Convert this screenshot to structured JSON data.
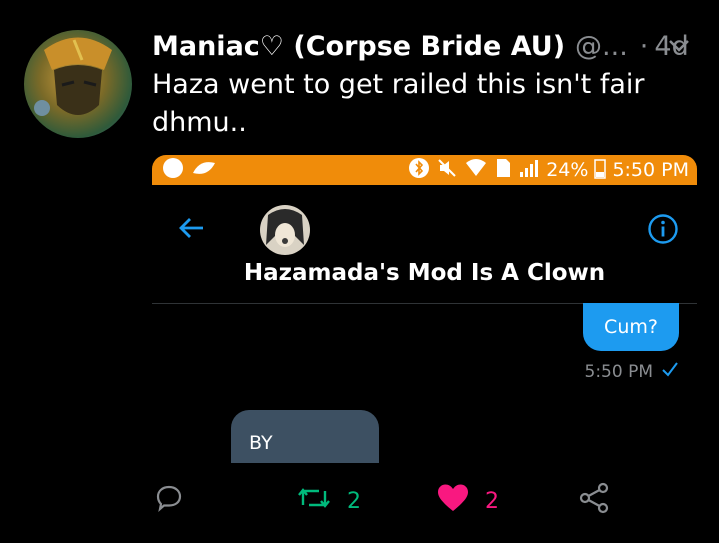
{
  "tweet": {
    "author_name": "Maniac♡ (Corpse Bride AU)",
    "author_handle": "@...",
    "separator": "·",
    "timestamp": "4d",
    "text": "Haza went to get railed this isn't fair dhmu.."
  },
  "screenshot": {
    "status_bar": {
      "battery": "24%",
      "clock": "5:50 PM"
    },
    "chat_title": "Hazamada's Mod Is A Clown",
    "messages": [
      {
        "from": "me",
        "text": "Cum?",
        "time": "5:50 PM"
      },
      {
        "from": "them",
        "text": "BY"
      }
    ]
  },
  "actions": {
    "retweets": "2",
    "likes": "2"
  },
  "colors": {
    "accent": "#1d9bf0",
    "status_bar": "#f08c0a",
    "retweet": "#00ba7c",
    "like": "#f91880",
    "muted": "#8a8d91"
  }
}
